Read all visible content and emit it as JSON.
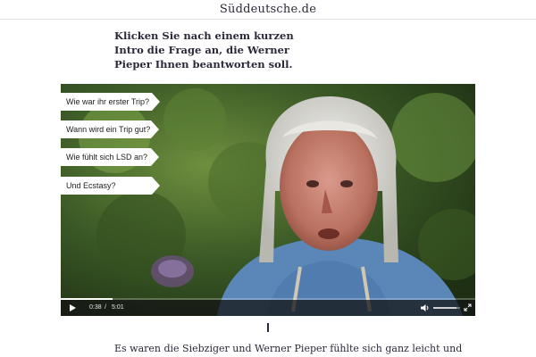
{
  "header": {
    "logo_text": "Süddeutsche.de"
  },
  "intro": {
    "text": "Klicken Sie nach einem kurzen Intro die Frage an, die Werner Pieper Ihnen beantworten soll."
  },
  "video": {
    "questions": [
      {
        "label": "Wie war ihr erster Trip?"
      },
      {
        "label": "Wann wird ein Trip gut?"
      },
      {
        "label": "Wie fühlt sich LSD an?"
      },
      {
        "label": "Und Ecstasy?"
      }
    ],
    "controls": {
      "current_time": "0:38",
      "separator": "/",
      "duration": "5:01",
      "progress_fraction": 0.126,
      "volume_fraction": 0.85,
      "play_icon": "play-icon",
      "volume_icon": "volume-icon",
      "fullscreen_icon": "fullscreen-icon"
    }
  },
  "article": {
    "body_text": "Es waren die Siebziger und Werner Pieper fühlte sich ganz leicht und"
  },
  "colors": {
    "text": "#29293a",
    "control_bar": "#141414",
    "question_bg": "#ffffff"
  }
}
